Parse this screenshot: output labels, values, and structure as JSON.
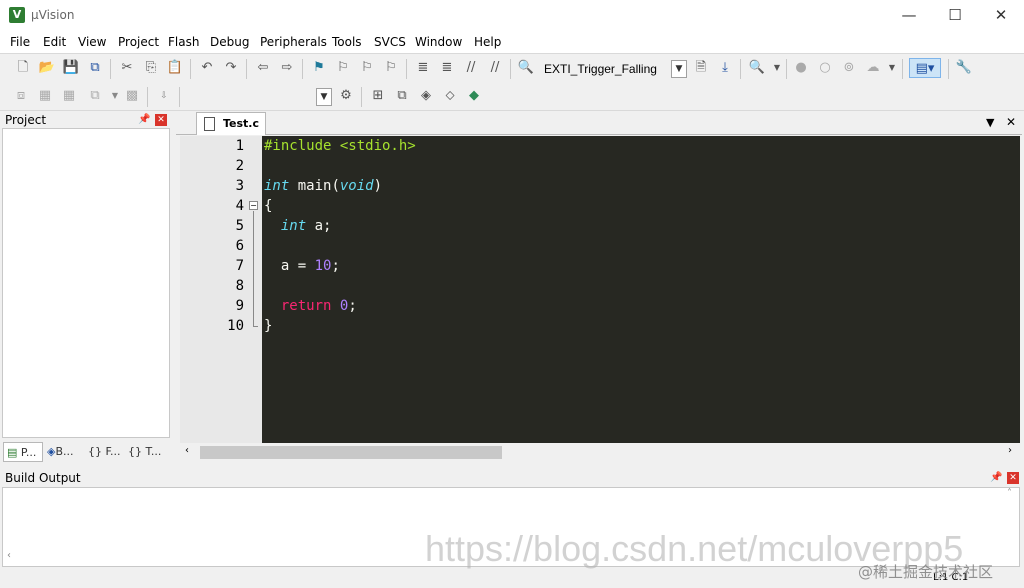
{
  "window": {
    "title": "µVision",
    "minimize": "—",
    "maximize": "☐",
    "close": "✕"
  },
  "menu": [
    "File",
    "Edit",
    "View",
    "Project",
    "Flash",
    "Debug",
    "Peripherals",
    "Tools",
    "SVCS",
    "Window",
    "Help"
  ],
  "toolbar": {
    "target": "EXTI_Trigger_Falling"
  },
  "project_panel": {
    "title": "Project",
    "tabs": [
      "P...",
      "B...",
      "F...",
      "T..."
    ]
  },
  "editor": {
    "tab": "Test.c",
    "lines": [
      "1",
      "2",
      "3",
      "4",
      "5",
      "6",
      "7",
      "8",
      "9",
      "10"
    ]
  },
  "build_output": {
    "title": "Build Output"
  },
  "status": {
    "cursor": "L:1 C:1"
  },
  "watermark": {
    "url": "https://blog.csdn.net/mculoverpp5",
    "site": "@稀土掘金技术社区"
  },
  "colors": {
    "editor_bg": "#272822",
    "keyword": "#66d9ef",
    "preprocessor": "#a6e22e",
    "number": "#ae81ff",
    "return_kw": "#f92672"
  }
}
